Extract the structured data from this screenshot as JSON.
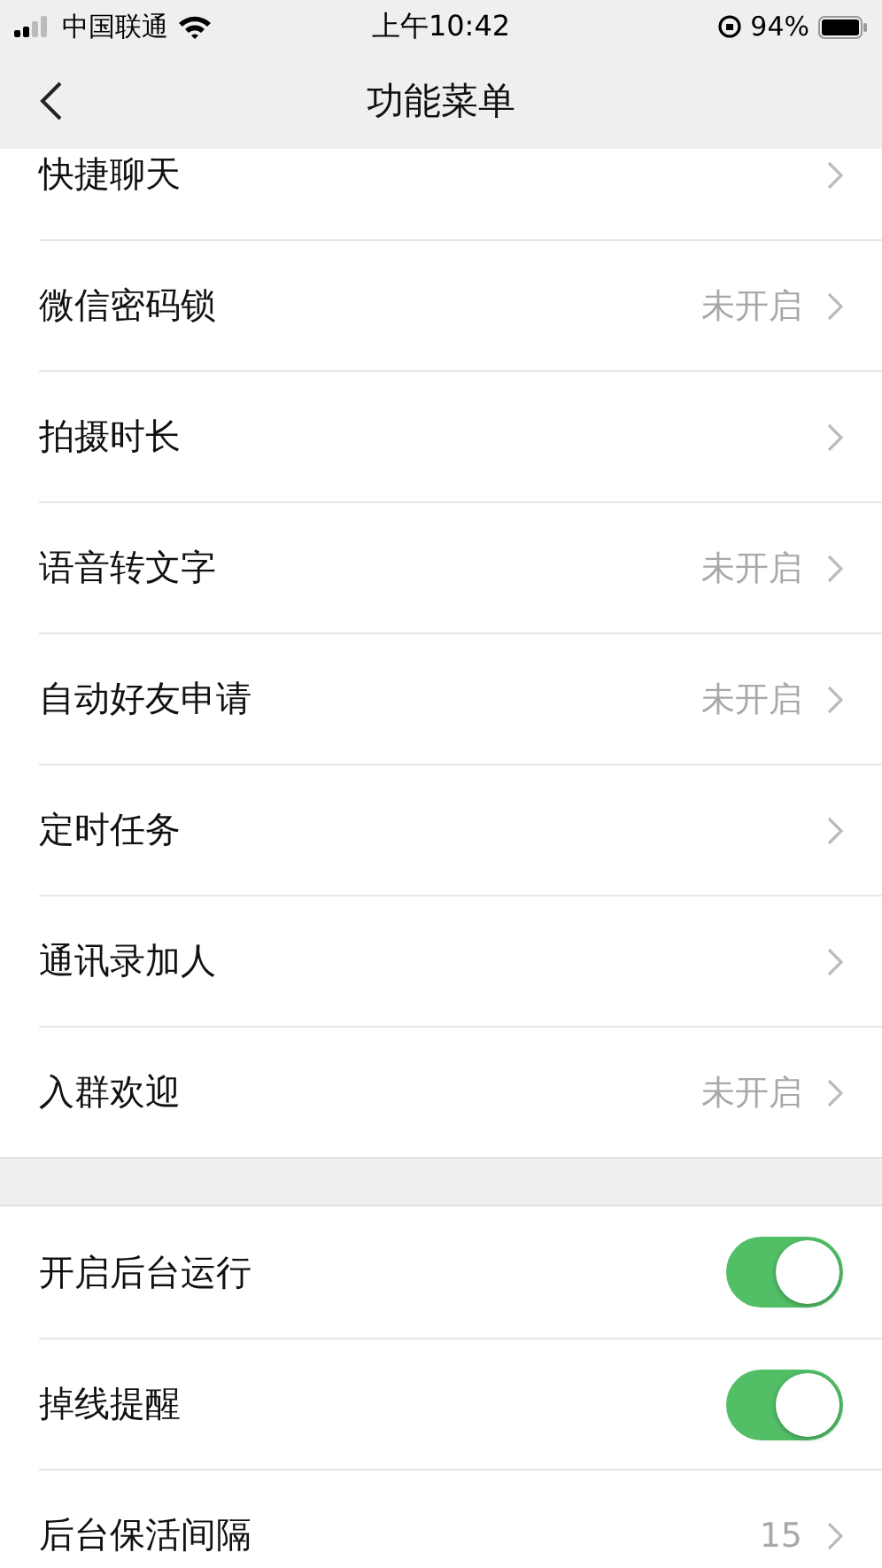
{
  "status_bar": {
    "carrier": "中国联通",
    "time": "上午10:42",
    "battery": "94%"
  },
  "nav": {
    "title": "功能菜单"
  },
  "sections": [
    {
      "items": [
        {
          "kind": "link",
          "label": "快捷聊天"
        },
        {
          "kind": "link",
          "label": "微信密码锁",
          "value": "未开启"
        },
        {
          "kind": "link",
          "label": "拍摄时长"
        },
        {
          "kind": "link",
          "label": "语音转文字",
          "value": "未开启"
        },
        {
          "kind": "link",
          "label": "自动好友申请",
          "value": "未开启"
        },
        {
          "kind": "link",
          "label": "定时任务"
        },
        {
          "kind": "link",
          "label": "通讯录加人"
        },
        {
          "kind": "link",
          "label": "入群欢迎",
          "value": "未开启"
        }
      ]
    },
    {
      "items": [
        {
          "kind": "toggle",
          "label": "开启后台运行",
          "on": true
        },
        {
          "kind": "toggle",
          "label": "掉线提醒",
          "on": true
        },
        {
          "kind": "link",
          "label": "后台保活间隔",
          "value": "15"
        }
      ]
    }
  ]
}
